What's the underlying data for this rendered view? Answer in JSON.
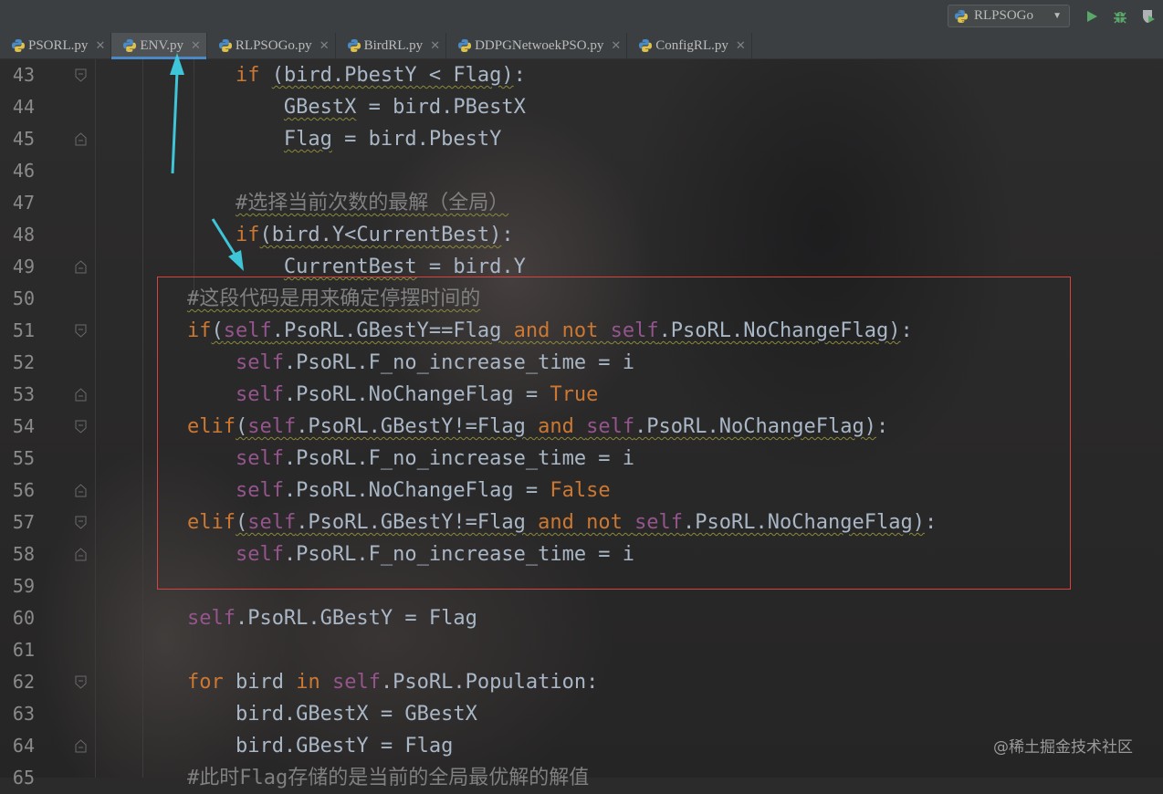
{
  "toolbar": {
    "run_config_label": "RLPSOGo",
    "run_icon": "run-icon",
    "debug_icon": "debug-icon",
    "coverage_icon": "coverage-icon"
  },
  "tabs": [
    {
      "label": "PSORL.py",
      "active": false
    },
    {
      "label": "ENV.py",
      "active": true
    },
    {
      "label": "RLPSOGo.py",
      "active": false
    },
    {
      "label": "BirdRL.py",
      "active": false
    },
    {
      "label": "DDPGNetwoekPSO.py",
      "active": false
    },
    {
      "label": "ConfigRL.py",
      "active": false
    }
  ],
  "code_lines": [
    {
      "n": "43",
      "tokens": [
        [
          "            ",
          ""
        ],
        [
          "if",
          "kw"
        ],
        [
          " ",
          ""
        ],
        [
          "(bird.PbestY < Flag)",
          "w"
        ],
        [
          ":",
          ""
        ]
      ]
    },
    {
      "n": "44",
      "tokens": [
        [
          "                ",
          ""
        ],
        [
          "GBestX",
          "w"
        ],
        [
          " = bird.PBestX",
          ""
        ]
      ]
    },
    {
      "n": "45",
      "tokens": [
        [
          "                ",
          ""
        ],
        [
          "Flag",
          "w"
        ],
        [
          " = bird.PbestY",
          ""
        ]
      ]
    },
    {
      "n": "46",
      "tokens": []
    },
    {
      "n": "47",
      "tokens": [
        [
          "            ",
          ""
        ],
        [
          "#选择当前次数的最解（全局）",
          "cmw"
        ]
      ]
    },
    {
      "n": "48",
      "tokens": [
        [
          "            ",
          ""
        ],
        [
          "if",
          "kw"
        ],
        [
          "(bird.Y<CurrentBest)",
          "w"
        ],
        [
          ":",
          ""
        ]
      ]
    },
    {
      "n": "49",
      "tokens": [
        [
          "                ",
          ""
        ],
        [
          "CurrentBest",
          "w"
        ],
        [
          " = bird.Y",
          ""
        ]
      ]
    },
    {
      "n": "50",
      "tokens": [
        [
          "        ",
          ""
        ],
        [
          "#这段代码是用来确定停摆时间的",
          "cmw"
        ]
      ]
    },
    {
      "n": "51",
      "tokens": [
        [
          "        ",
          ""
        ],
        [
          "if",
          "kw"
        ],
        [
          "(",
          "w"
        ],
        [
          "self",
          "selfw"
        ],
        [
          ".PsoRL.GBestY==Flag ",
          "w"
        ],
        [
          "and not ",
          "kww"
        ],
        [
          "self",
          "selfw"
        ],
        [
          ".PsoRL.NoChangeFlag)",
          "w"
        ],
        [
          ":",
          ""
        ]
      ]
    },
    {
      "n": "52",
      "tokens": [
        [
          "            ",
          ""
        ],
        [
          "self",
          "self"
        ],
        [
          ".PsoRL.F_no_increase_time = i",
          ""
        ]
      ]
    },
    {
      "n": "53",
      "tokens": [
        [
          "            ",
          ""
        ],
        [
          "self",
          "self"
        ],
        [
          ".PsoRL.NoChangeFlag = ",
          ""
        ],
        [
          "True",
          "kw"
        ]
      ]
    },
    {
      "n": "54",
      "tokens": [
        [
          "        ",
          ""
        ],
        [
          "elif",
          "kw"
        ],
        [
          "(",
          "w"
        ],
        [
          "self",
          "selfw"
        ],
        [
          ".PsoRL.GBestY!=Flag ",
          "w"
        ],
        [
          "and ",
          "kww"
        ],
        [
          "self",
          "selfw"
        ],
        [
          ".PsoRL.NoChangeFlag)",
          "w"
        ],
        [
          ":",
          ""
        ]
      ]
    },
    {
      "n": "55",
      "tokens": [
        [
          "            ",
          ""
        ],
        [
          "self",
          "self"
        ],
        [
          ".PsoRL.F_no_increase_time = i",
          ""
        ]
      ]
    },
    {
      "n": "56",
      "tokens": [
        [
          "            ",
          ""
        ],
        [
          "self",
          "self"
        ],
        [
          ".PsoRL.NoChangeFlag = ",
          ""
        ],
        [
          "False",
          "kw"
        ]
      ]
    },
    {
      "n": "57",
      "tokens": [
        [
          "        ",
          ""
        ],
        [
          "elif",
          "kw"
        ],
        [
          "(",
          "w"
        ],
        [
          "self",
          "selfw"
        ],
        [
          ".PsoRL.GBestY!=Flag ",
          "w"
        ],
        [
          "and not ",
          "kww"
        ],
        [
          "self",
          "selfw"
        ],
        [
          ".PsoRL.NoChangeFlag)",
          "w"
        ],
        [
          ":",
          ""
        ]
      ]
    },
    {
      "n": "58",
      "tokens": [
        [
          "            ",
          ""
        ],
        [
          "self",
          "self"
        ],
        [
          ".PsoRL.F_no_increase_time = i",
          ""
        ]
      ]
    },
    {
      "n": "59",
      "tokens": []
    },
    {
      "n": "60",
      "tokens": [
        [
          "        ",
          ""
        ],
        [
          "self",
          "self"
        ],
        [
          ".PsoRL.GBestY = Flag",
          ""
        ]
      ]
    },
    {
      "n": "61",
      "tokens": []
    },
    {
      "n": "62",
      "tokens": [
        [
          "        ",
          ""
        ],
        [
          "for",
          "kw"
        ],
        [
          " bird ",
          ""
        ],
        [
          "in",
          "kw"
        ],
        [
          " ",
          ""
        ],
        [
          "self",
          "self"
        ],
        [
          ".PsoRL.Population:",
          ""
        ]
      ]
    },
    {
      "n": "63",
      "tokens": [
        [
          "            ",
          ""
        ],
        [
          "bird.GBestX = GBestX",
          ""
        ]
      ]
    },
    {
      "n": "64",
      "tokens": [
        [
          "            ",
          ""
        ],
        [
          "bird.GBestY = Flag",
          ""
        ]
      ]
    },
    {
      "n": "65",
      "tokens": [
        [
          "        ",
          ""
        ],
        [
          "#此时Flag存储的是当前的全局最优解的解值",
          "cm"
        ]
      ]
    }
  ],
  "watermark": "@稀土掘金技术社区"
}
